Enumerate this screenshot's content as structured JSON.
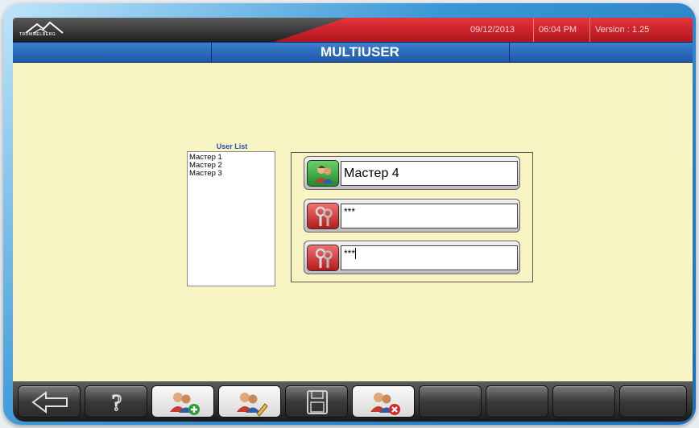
{
  "header": {
    "date": "09/12/2013",
    "time": "06:04 PM",
    "version": "Version : 1.25",
    "logo_text": "TROMMELBERG",
    "title": "MULTIUSER"
  },
  "user_list": {
    "title": "User List",
    "items": [
      "Мастер 1",
      "Мастер 2",
      "Мастер 3"
    ]
  },
  "form": {
    "username_value": "Мастер 4",
    "password_value": "***",
    "confirm_password_value": "***"
  },
  "toolbar": {
    "buttons": [
      {
        "icon": "back-arrow-icon"
      },
      {
        "icon": "help-icon"
      },
      {
        "icon": "add-user-icon"
      },
      {
        "icon": "edit-user-icon"
      },
      {
        "icon": "save-icon"
      },
      {
        "icon": "delete-user-icon"
      },
      {
        "icon": ""
      },
      {
        "icon": ""
      },
      {
        "icon": ""
      },
      {
        "icon": ""
      }
    ]
  },
  "colors": {
    "background": "#f9f4c3",
    "title_bar": "#2a6bbf",
    "status_bar_red": "#c8232a",
    "green_button": "#2f9e3a",
    "red_button": "#c42626"
  }
}
